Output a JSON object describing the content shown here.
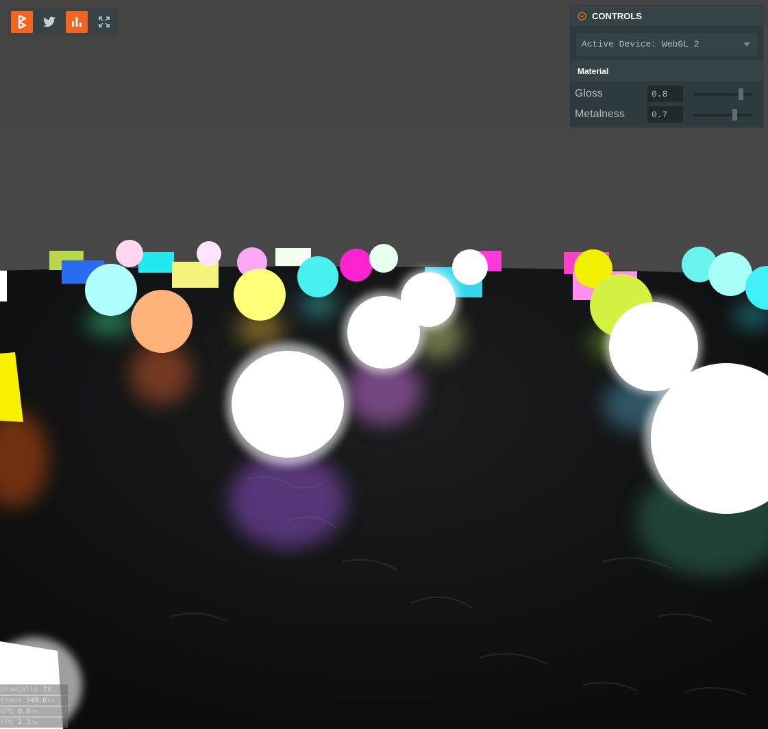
{
  "toolbar": {
    "buttons": [
      {
        "icon": "playcanvas-logo-icon",
        "style": "orange"
      },
      {
        "icon": "twitter-bird-icon",
        "style": "dark"
      },
      {
        "icon": "bar-chart-icon",
        "style": "orange"
      },
      {
        "icon": "fullscreen-icon",
        "style": "dark"
      }
    ]
  },
  "controls": {
    "title": "CONTROLS",
    "icon": "collapse-chevron-icon",
    "active_device": "Active Device: WebGL 2",
    "section_title": "Material",
    "sliders": [
      {
        "label": "Gloss",
        "value": "0.8",
        "fraction": 0.8
      },
      {
        "label": "Metalness",
        "value": "0.7",
        "fraction": 0.7
      }
    ]
  },
  "stats": [
    {
      "label": "DrawCalls",
      "value": "73",
      "unit": ""
    },
    {
      "label": "Frame",
      "value": "749.6",
      "unit": "ms"
    },
    {
      "label": "GPU",
      "value": "0.0",
      "unit": "ms"
    },
    {
      "label": "CPU",
      "value": "2.3",
      "unit": "ms"
    }
  ],
  "colors": {
    "accent": "#f26422",
    "panel": "#2e3b3e",
    "panel_header": "#364346",
    "sky": "#454545",
    "floor": "#121414"
  }
}
